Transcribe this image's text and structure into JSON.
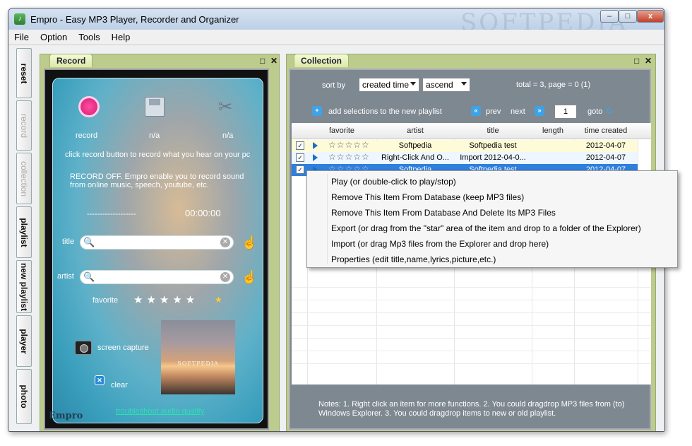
{
  "window": {
    "title": "Empro - Easy MP3 Player, Recorder and Organizer",
    "watermark": "SOFTPEDIA",
    "buttons": {
      "minimize": "–",
      "maximize": "□",
      "close": "x"
    }
  },
  "menu": [
    "File",
    "Option",
    "Tools",
    "Help"
  ],
  "side_tabs": [
    {
      "label": "reset",
      "enabled": true
    },
    {
      "label": "record",
      "enabled": false
    },
    {
      "label": "collection",
      "enabled": false
    },
    {
      "label": "playlist",
      "enabled": true
    },
    {
      "label": "new playlist",
      "enabled": true
    },
    {
      "label": "player",
      "enabled": true
    },
    {
      "label": "photo",
      "enabled": true
    }
  ],
  "record_panel": {
    "tab_label": "Record",
    "controls": {
      "max": "□",
      "close": "✕"
    },
    "icons": [
      {
        "icon": "record-icon",
        "label": "record"
      },
      {
        "icon": "save-icon",
        "label": "n/a"
      },
      {
        "icon": "scissors-icon",
        "label": "n/a"
      }
    ],
    "hint": "click record button to record what you hear on your pc",
    "status_line1": "RECORD OFF. Empro enable you to record sound",
    "status_line2": "from online music, speech, youtube, etc.",
    "level": "-------------------",
    "timer": "00:00:00",
    "title_label": "title",
    "title_value": "",
    "artist_label": "artist",
    "artist_value": "",
    "favorite_label": "favorite",
    "favorite_stars": "★★★★★",
    "screen_capture": "screen capture",
    "photo_caption": "SOFTPEDIA",
    "clear": "clear",
    "troubleshoot": "troubleshoot audio quality",
    "logo": "Empro"
  },
  "collection_panel": {
    "tab_label": "Collection",
    "controls": {
      "max": "□",
      "close": "✕"
    },
    "sort_by_label": "sort by",
    "sort_field": "created time",
    "sort_order": "ascend",
    "total": "total = 3, page = 0 (1)",
    "add_selections": "add selections to the new playlist",
    "prev": "prev",
    "next": "next",
    "page_input": "1",
    "goto": "goto",
    "columns": [
      "favorite",
      "artist",
      "title",
      "length",
      "time created"
    ],
    "rows": [
      {
        "checked": "✓",
        "stars": "☆☆☆☆☆",
        "artist": "Softpedia",
        "title": "Softpedia test",
        "length": "",
        "time_created": "2012-04-07"
      },
      {
        "checked": "✓",
        "stars": "☆☆☆☆☆",
        "artist": "Right-Click And O...",
        "title": "Import 2012-04-0...",
        "length": "",
        "time_created": "2012-04-07"
      },
      {
        "checked": "✓",
        "stars": "☆☆☆☆☆",
        "artist": "Softpedia",
        "title": "Softpedia test",
        "length": "",
        "time_created": "2012-04-07"
      }
    ],
    "notes_line1": "Notes: 1. Right click an item for more functions. 2. You could dragdrop MP3 files from (to)",
    "notes_line2": "Windows Explorer. 3. You could dragdrop items to new or old playlist."
  },
  "context_menu": [
    "Play (or double-click to play/stop)",
    "Remove This Item From Database (keep MP3 files)",
    "Remove This Item From Database And Delete Its MP3 Files",
    "Export (or drag from the \"star\" area of the item and drop to a folder of the Explorer)",
    "Import (or drag Mp3 files from the Explorer and drop here)",
    "Properties (edit title,name,lyrics,picture,etc.)"
  ],
  "colors": {
    "panel_tab": "#dce9a8",
    "selected_row": "#2f7fdc",
    "highlight_row": "#fdfbd8",
    "link": "#2ce1b2"
  }
}
